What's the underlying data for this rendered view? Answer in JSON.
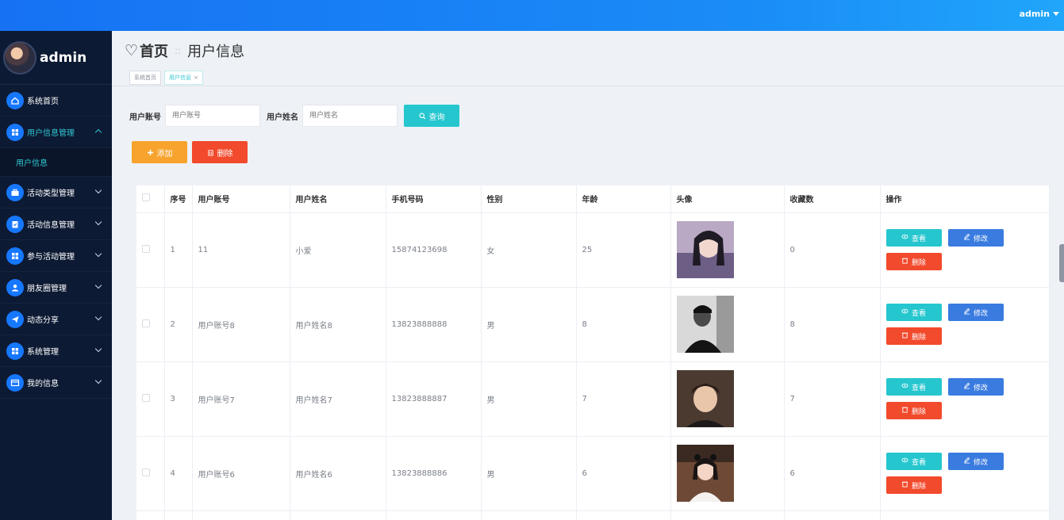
{
  "topbar": {
    "user": "admin"
  },
  "sidebar": {
    "brand": "admin",
    "items": [
      {
        "label": "系统首页",
        "icon": "home-icon",
        "expandable": false
      },
      {
        "label": "用户信息管理",
        "icon": "grid-icon",
        "expandable": true,
        "expanded": true,
        "children": [
          "用户信息"
        ]
      },
      {
        "label": "活动类型管理",
        "icon": "briefcase-icon",
        "expandable": true
      },
      {
        "label": "活动信息管理",
        "icon": "clipboard-icon",
        "expandable": true
      },
      {
        "label": "参与活动管理",
        "icon": "grid-icon",
        "expandable": true
      },
      {
        "label": "朋友圈管理",
        "icon": "user-icon",
        "expandable": true
      },
      {
        "label": "动态分享",
        "icon": "send-icon",
        "expandable": true
      },
      {
        "label": "系统管理",
        "icon": "grid-icon",
        "expandable": true
      },
      {
        "label": "我的信息",
        "icon": "card-icon",
        "expandable": true
      }
    ]
  },
  "breadcrumb": {
    "home": "首页",
    "current": "用户信息"
  },
  "tabs": [
    {
      "label": "系统首页",
      "active": false
    },
    {
      "label": "用户信息",
      "active": true,
      "closable": true
    }
  ],
  "search": {
    "account_label": "用户账号",
    "account_placeholder": "用户账号",
    "name_label": "用户姓名",
    "name_placeholder": "用户姓名",
    "query_label": "查询"
  },
  "actions": {
    "add_label": "添加",
    "delete_label": "删除"
  },
  "table": {
    "columns": [
      "序号",
      "用户账号",
      "用户姓名",
      "手机号码",
      "性别",
      "年龄",
      "头像",
      "收藏数",
      "操作"
    ],
    "rows": [
      {
        "index": "1",
        "account": "11",
        "name": "小爱",
        "phone": "15874123698",
        "gender": "女",
        "age": "25",
        "favorites": "0"
      },
      {
        "index": "2",
        "account": "用户账号8",
        "name": "用户姓名8",
        "phone": "13823888888",
        "gender": "男",
        "age": "8",
        "favorites": "8"
      },
      {
        "index": "3",
        "account": "用户账号7",
        "name": "用户姓名7",
        "phone": "13823888887",
        "gender": "男",
        "age": "7",
        "favorites": "7"
      },
      {
        "index": "4",
        "account": "用户账号6",
        "name": "用户姓名6",
        "phone": "13823888886",
        "gender": "男",
        "age": "6",
        "favorites": "6"
      }
    ],
    "row_actions": {
      "view": "查看",
      "edit": "修改",
      "delete": "删除"
    }
  },
  "colors": {
    "accent": "#26c6cf",
    "primary": "#1677ff",
    "warning": "#f7a32d",
    "danger": "#f24a2c",
    "edit": "#3a7be0",
    "sidebar": "#0d1a33"
  }
}
